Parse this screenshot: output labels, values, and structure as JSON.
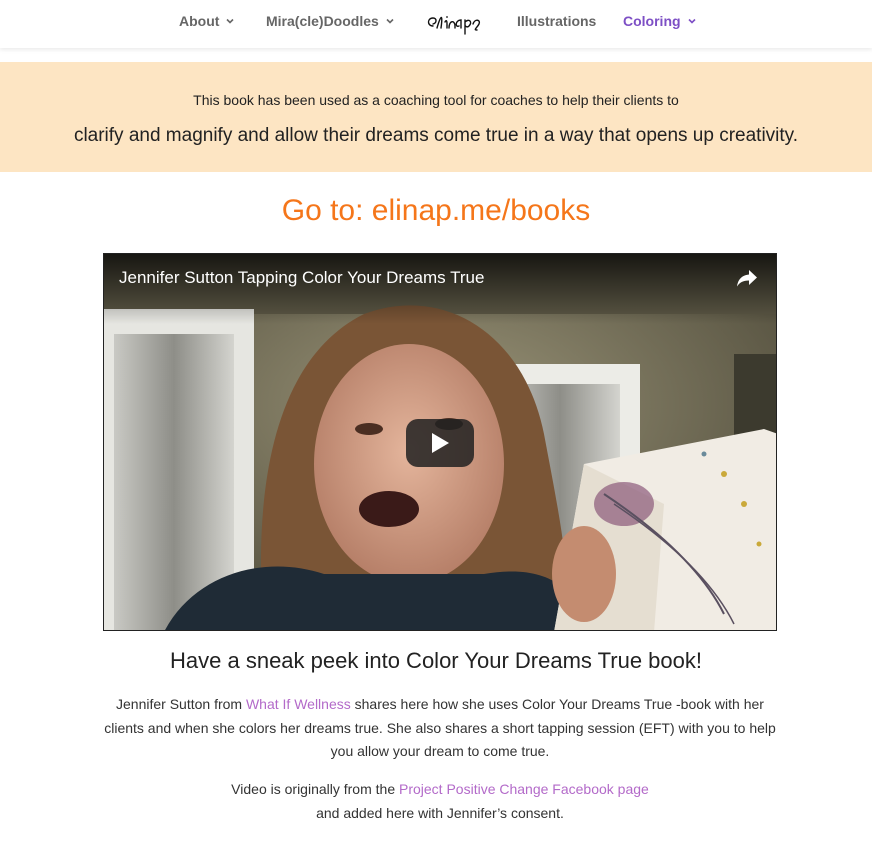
{
  "nav": {
    "about": "About",
    "doodles": "Mira(cle)Doodles",
    "logo_text": "elinap",
    "illustrations": "Illustrations",
    "coloring": "Coloring"
  },
  "banner": {
    "line1": "This book has been used as a coaching tool for coaches to help their clients to",
    "line2": "clarify and magnify and allow their dreams come true in a way that opens up creativity."
  },
  "goto": "Go to: elinap.me/books",
  "video": {
    "title": "Jennifer Sutton Tapping Color Your Dreams True",
    "share_icon": "share-icon",
    "play_icon": "play-icon"
  },
  "heading": "Have a sneak peek into Color Your Dreams True book!",
  "para1": {
    "before": "Jennifer Sutton from ",
    "link": "What If Wellness",
    "after": " shares here how she uses Color Your Dreams True -book with her clients and when she colors her dreams true. She also shares a short tapping session (EFT) with you to help you allow your dream to come true."
  },
  "para2": {
    "before": "Video is originally from the ",
    "link": "Project Positive Change Facebook page",
    "after": "and added here with Jennifer’s consent."
  },
  "colors": {
    "accent_purple": "#7d4fc5",
    "banner_bg": "#fde5c3",
    "goto_orange": "#f5761a",
    "link_purple": "#b36ac9"
  }
}
